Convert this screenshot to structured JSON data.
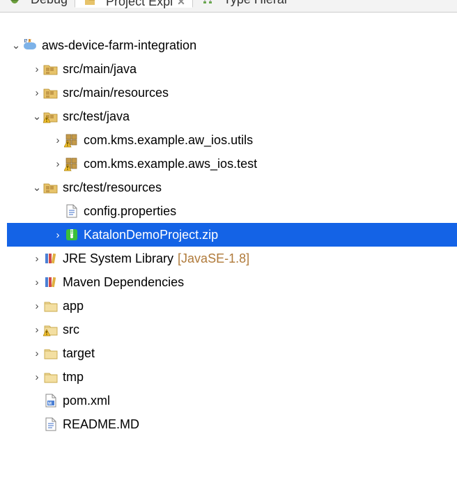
{
  "tabs": {
    "debug": "Debug",
    "project_explorer": "Project Expl",
    "type_hierarchy": "Type Hierar"
  },
  "tree": {
    "root": "aws-device-farm-integration",
    "src_main_java": "src/main/java",
    "src_main_resources": "src/main/resources",
    "src_test_java": "src/test/java",
    "pkg_utils": "com.kms.example.aw_ios.utils",
    "pkg_test": "com.kms.example.aws_ios.test",
    "src_test_resources": "src/test/resources",
    "config_properties": "config.properties",
    "katalon_zip": "KatalonDemoProject.zip",
    "jre_label": "JRE System Library",
    "jre_suffix": "[JavaSE-1.8]",
    "maven_deps": "Maven Dependencies",
    "folder_app": "app",
    "folder_src": "src",
    "folder_target": "target",
    "folder_tmp": "tmp",
    "pom_xml": "pom.xml",
    "readme": "README.MD"
  }
}
